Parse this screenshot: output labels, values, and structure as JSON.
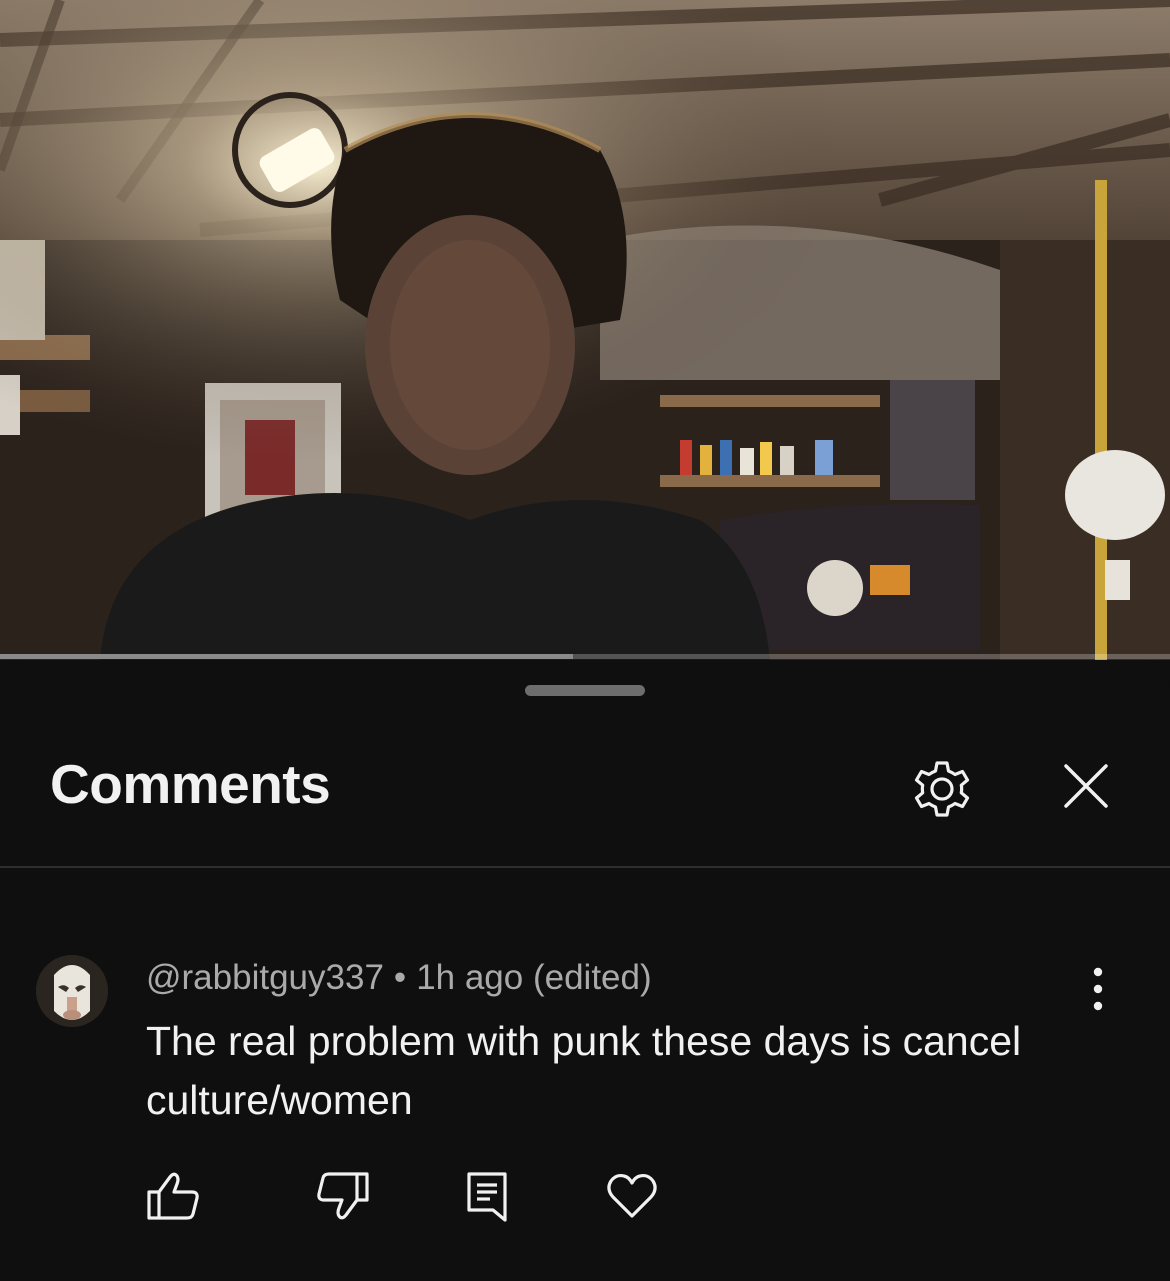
{
  "video": {
    "progress_fraction": 0.49,
    "icons": [
      "person-in-garage-scene"
    ]
  },
  "comments_sheet": {
    "title": "Comments",
    "icons": {
      "settings": "gear-icon",
      "close": "close-icon",
      "more": "more-vert-icon",
      "like": "thumbs-up-icon",
      "dislike": "thumbs-down-icon",
      "reply": "reply-icon",
      "heart": "heart-icon"
    },
    "comment": {
      "author": "@rabbitguy337",
      "separator": "•",
      "time": "1h ago (edited)",
      "text": "The real problem with punk these days is cancel culture/women"
    }
  },
  "colors": {
    "background": "#0f0f0f",
    "text_primary": "#f1f1f1",
    "text_secondary": "#aaaaaa",
    "divider": "#2e2e2e"
  }
}
